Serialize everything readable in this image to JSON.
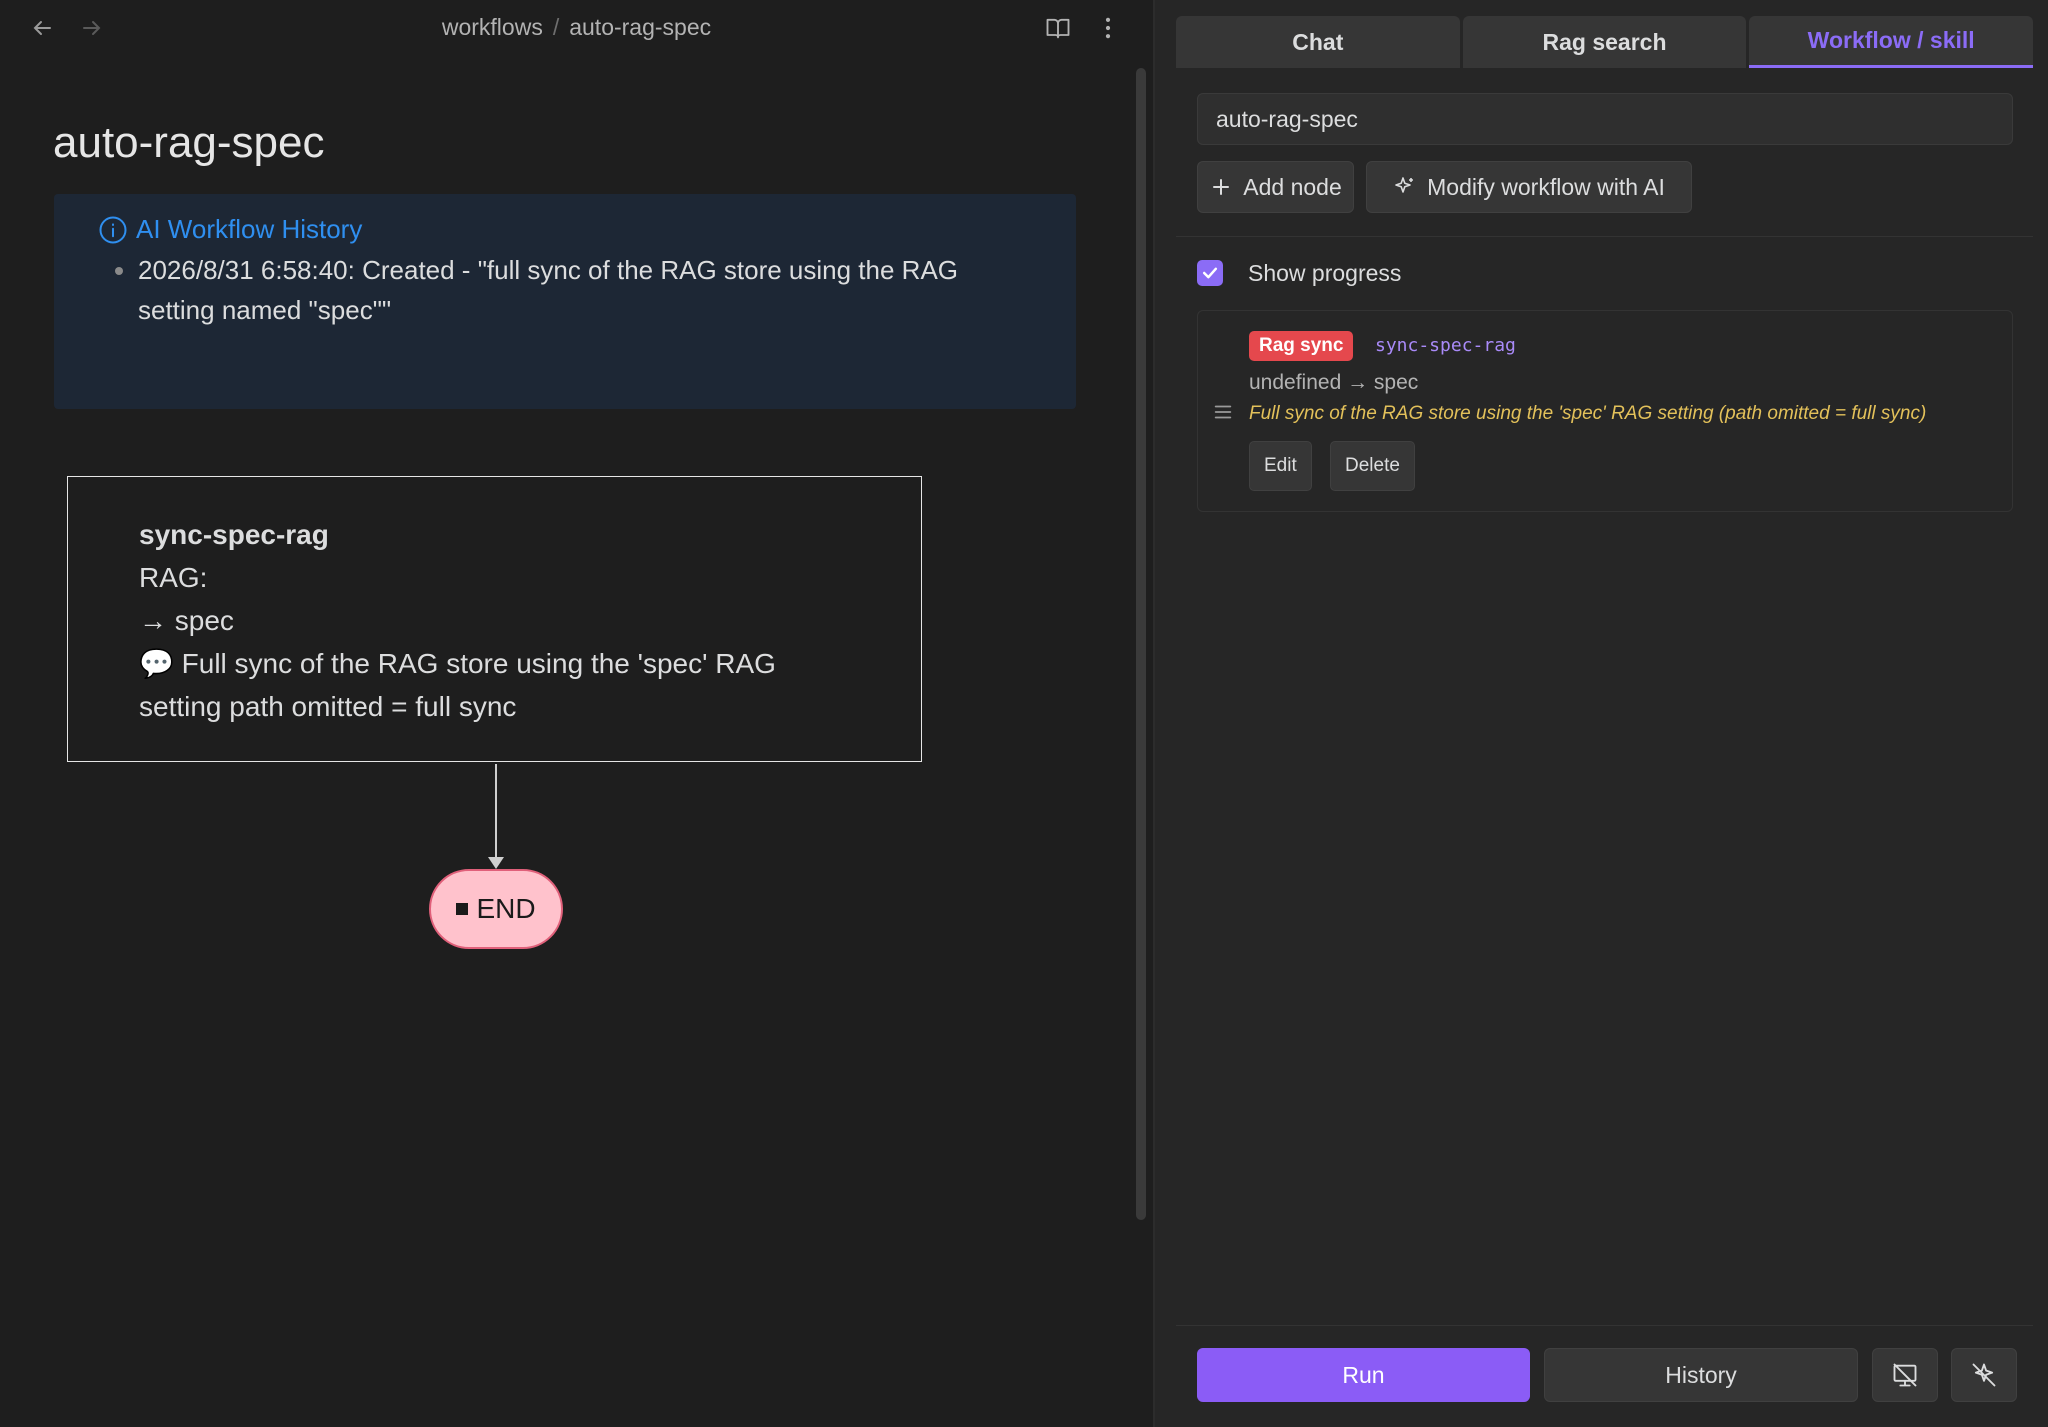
{
  "breadcrumb": {
    "parent": "workflows",
    "separator": "/",
    "current": "auto-rag-spec"
  },
  "page": {
    "title": "auto-rag-spec"
  },
  "history_callout": {
    "title": "AI Workflow History",
    "entries": [
      "2026/8/31 6:58:40: Created - \"full sync of the RAG store using the RAG setting named \"spec\"\""
    ]
  },
  "diagram": {
    "node_name": "sync-spec-rag",
    "rag_line": "RAG:",
    "arrow_line": "→ spec",
    "comment_icon": "💬",
    "comment_text": "Full sync of the RAG store using the 'spec' RAG setting path omitted = full sync",
    "end_label": "END"
  },
  "tabs": [
    {
      "label": "Chat",
      "active": false
    },
    {
      "label": "Rag search",
      "active": false
    },
    {
      "label": "Workflow / skill",
      "active": true
    }
  ],
  "workflow": {
    "name_value": "auto-rag-spec",
    "add_node_label": "Add node",
    "modify_ai_label": "Modify workflow with AI",
    "show_progress_label": "Show progress",
    "show_progress_checked": true
  },
  "node_card": {
    "badge": "Rag sync",
    "badge_color": "#e5484d",
    "id": "sync-spec-rag",
    "io": "undefined → spec",
    "comment": "Full sync of the RAG store using the 'spec' RAG setting (path omitted = full sync)",
    "edit_label": "Edit",
    "delete_label": "Delete"
  },
  "footer": {
    "run_label": "Run",
    "history_label": "History"
  },
  "colors": {
    "accent": "#8b6cf6",
    "run": "#8b5cf6",
    "callout_title": "#2f8ff0",
    "end_fill": "#ffc2cc",
    "comment": "#e3c15a"
  },
  "icons": [
    "back-arrow-icon",
    "forward-arrow-icon",
    "book-icon",
    "more-vertical-icon",
    "info-icon",
    "plus-icon",
    "sparkle-icon",
    "checkmark-icon",
    "drag-handle-icon",
    "screen-off-icon",
    "sparkle-off-icon"
  ]
}
